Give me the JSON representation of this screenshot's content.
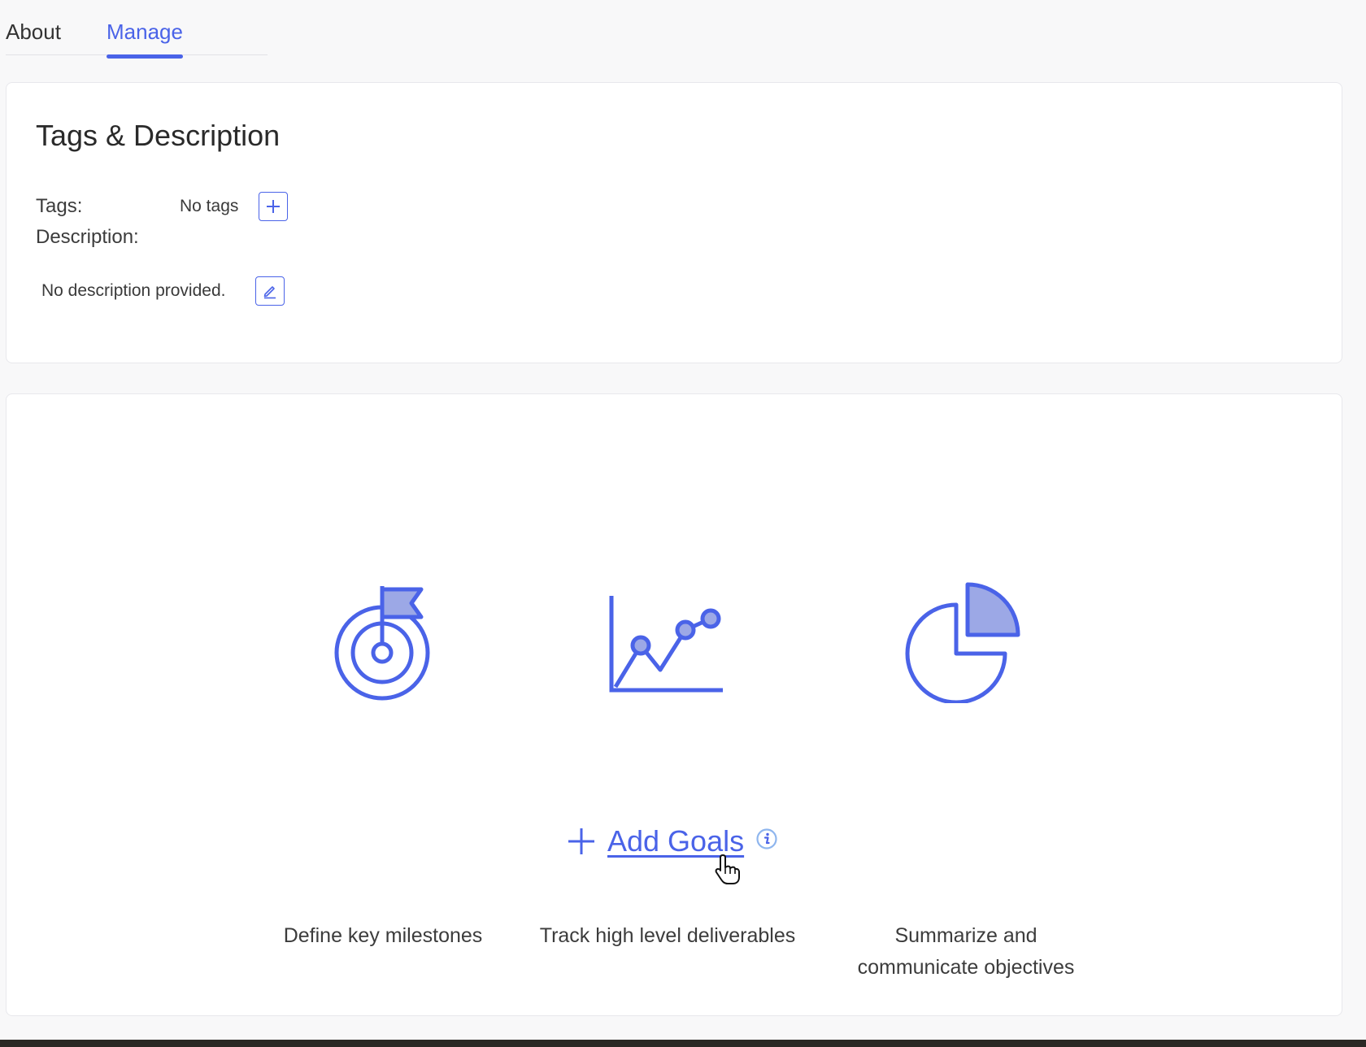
{
  "tabs": {
    "about": "About",
    "manage": "Manage",
    "active": "Manage"
  },
  "tags_card": {
    "title": "Tags & Description",
    "tags_label": "Tags:",
    "tags_value": "No tags",
    "description_label": "Description:",
    "description_value": "No description provided.",
    "add_tag_icon": "plus-icon",
    "edit_description_icon": "pencil-icon"
  },
  "goals_card": {
    "features": [
      {
        "icon": "target-flag-icon",
        "text": "Define key milestones"
      },
      {
        "icon": "line-chart-icon",
        "text": "Track high level deliverables"
      },
      {
        "icon": "pie-chart-icon",
        "text": "Summarize and communicate objectives"
      }
    ],
    "add_goals_label": "Add Goals",
    "info_icon": "info-icon"
  },
  "colors": {
    "accent": "#4a63e8",
    "accent_fill": "#9ca8e6",
    "text": "#333333",
    "page_background": "#f8f8f9",
    "card_background": "#ffffff"
  }
}
